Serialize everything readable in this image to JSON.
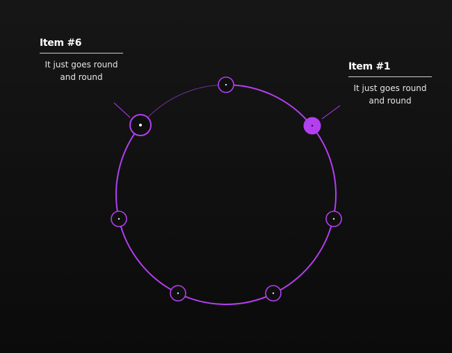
{
  "colors": {
    "accent": "#b33ff0",
    "accent_dim": "#7a2fa3",
    "background_top": "#161617",
    "background_bottom": "#0b0b0b",
    "text": "#e9e9ea"
  },
  "carousel": {
    "items_count": 7,
    "active_item": 1,
    "hovered_item": 6,
    "progress_fraction": 0.86
  },
  "callouts": {
    "left": {
      "title": "Item #6",
      "description_line1": "It just goes round",
      "description_line2": "and round"
    },
    "right": {
      "title": "Item #1",
      "description_line1": "It just goes round",
      "description_line2": "and round"
    }
  }
}
